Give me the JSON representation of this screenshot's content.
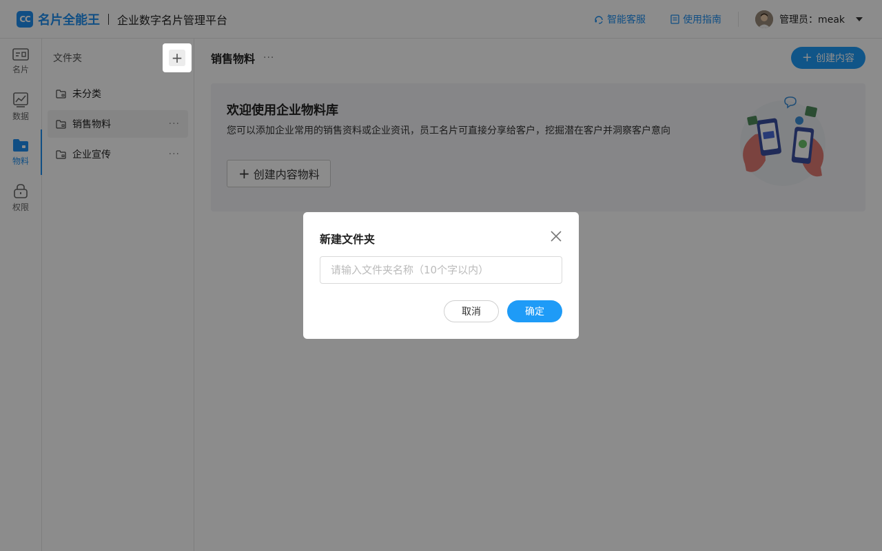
{
  "header": {
    "logo_text": "名片全能王",
    "logo_mark": "CC",
    "platform_title": "企业数字名片管理平台",
    "links": [
      {
        "label": "智能客服",
        "icon": "headset-icon"
      },
      {
        "label": "使用指南",
        "icon": "document-icon"
      }
    ],
    "user_label": "管理员：meak"
  },
  "leftnav": {
    "items": [
      {
        "label": "名片",
        "icon": "card-icon"
      },
      {
        "label": "数据",
        "icon": "chart-icon"
      },
      {
        "label": "物料",
        "icon": "folder-icon",
        "active": true
      },
      {
        "label": "权限",
        "icon": "lock-icon"
      }
    ]
  },
  "folders": {
    "title": "文件夹",
    "add_symbol": "+",
    "items": [
      {
        "name": "未分类"
      },
      {
        "name": "销售物料",
        "selected": true,
        "more": "···"
      },
      {
        "name": "企业宣传",
        "more": "···"
      }
    ]
  },
  "main": {
    "title": "销售物料",
    "more": "···",
    "create_button": "创建内容",
    "banner": {
      "title": "欢迎使用企业物料库",
      "description": "您可以添加企业常用的销售资料或企业资讯，员工名片可直接分享给客户，挖掘潜在客户并洞察客户意向",
      "button": "创建内容物料"
    }
  },
  "modal": {
    "title": "新建文件夹",
    "input_value": "",
    "input_placeholder": "请输入文件夹名称（10个字以内）",
    "cancel": "取消",
    "confirm": "确定"
  },
  "colors": {
    "accent": "#1e9bf7",
    "brand": "#1e8ff0"
  }
}
